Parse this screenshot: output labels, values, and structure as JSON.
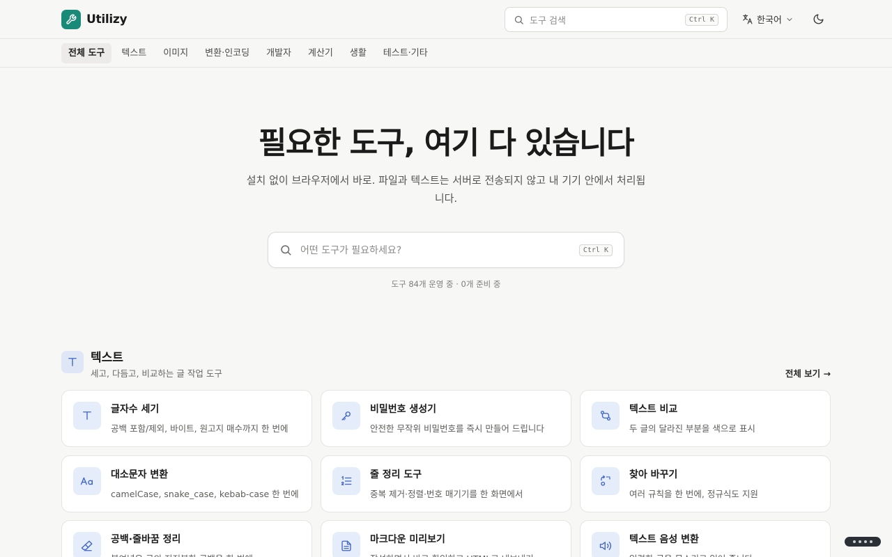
{
  "app": {
    "name": "Utilizy",
    "accent": "#1a8a78"
  },
  "header": {
    "search_placeholder": "도구 검색",
    "search_shortcut": "Ctrl K",
    "language": "한국어"
  },
  "nav": {
    "items": [
      {
        "label": "전체 도구",
        "active": true
      },
      {
        "label": "텍스트"
      },
      {
        "label": "이미지"
      },
      {
        "label": "변환·인코딩"
      },
      {
        "label": "개발자"
      },
      {
        "label": "계산기"
      },
      {
        "label": "생활"
      },
      {
        "label": "테스트·기타"
      }
    ]
  },
  "hero": {
    "title": "필요한 도구, 여기 다 있습니다",
    "subtitle": "설치 없이 브라우저에서 바로. 파일과 텍스트는 서버로 전송되지 않고 내 기기 안에서 처리됩니다.",
    "search_placeholder": "어떤 도구가 필요하세요?",
    "search_shortcut": "Ctrl K",
    "stats": "도구 84개 운영 중 · 0개 준비 중"
  },
  "section": {
    "title": "텍스트",
    "description": "세고, 다듬고, 비교하는 글 작업 도구",
    "see_all": "전체 보기 →",
    "icon": "text-t-icon",
    "cards": [
      {
        "title": "글자수 세기",
        "desc": "공백 포함/제외, 바이트, 원고지 매수까지 한 번에",
        "icon": "text-t-icon"
      },
      {
        "title": "비밀번호 생성기",
        "desc": "안전한 무작위 비밀번호를 즉시 만들어 드립니다",
        "icon": "key-icon"
      },
      {
        "title": "텍스트 비교",
        "desc": "두 글의 달라진 부분을 색으로 표시",
        "icon": "diff-icon"
      },
      {
        "title": "대소문자 변환",
        "desc": "camelCase, snake_case, kebab-case 한 번에",
        "icon": "case-icon"
      },
      {
        "title": "줄 정리 도구",
        "desc": "중복 제거·정렬·번호 매기기를 한 화면에서",
        "icon": "list-ordered-icon"
      },
      {
        "title": "찾아 바꾸기",
        "desc": "여러 규칙을 한 번에, 정규식도 지원",
        "icon": "replace-icon"
      },
      {
        "title": "공백·줄바꿈 정리",
        "desc": "붙여넣은 글의 지저분한 공백을 한 번에",
        "icon": "eraser-icon"
      },
      {
        "title": "마크다운 미리보기",
        "desc": "작성하면서 바로 확인하고 HTML로 내보내기",
        "icon": "file-text-icon"
      },
      {
        "title": "텍스트 음성 변환",
        "desc": "입력한 글을 목소리로 읽어 줍니다",
        "icon": "speaker-icon"
      }
    ]
  }
}
